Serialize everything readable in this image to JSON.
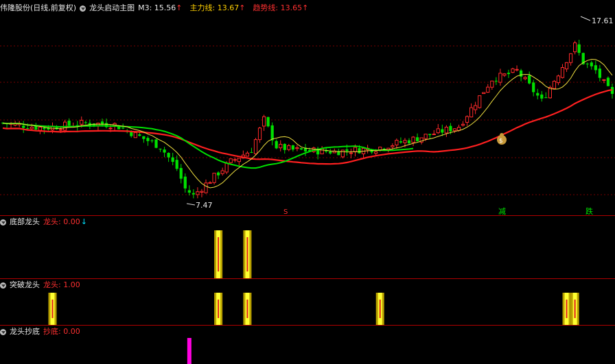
{
  "main_panel": {
    "stock_name": "伟隆股份(日线,前复权)",
    "indicator_name": "龙头启动主图",
    "m3_label": "M3: 15.56",
    "main_force_label": "主力线: 13.67",
    "trend_label": "趋势线: 13.65",
    "up_arrow": "↑",
    "high_price_label": "17.61",
    "low_price_label": "7.47",
    "signal_labels": {
      "jian": "减",
      "die": "跌",
      "s": "S"
    },
    "colors": {
      "up": "#ff2a2a",
      "down": "#00e000",
      "trend": "#ff2020",
      "main_force": "#00e000",
      "m3": "#f0e040"
    }
  },
  "panel_bottom": {
    "title": "底部龙头",
    "value_label": "龙头: 0.00",
    "down_arrow": "↓",
    "signals": [
      "2022-04-27",
      "2022-05-10"
    ]
  },
  "panel_breakout": {
    "title": "突破龙头",
    "value_label": "龙头: 1.00",
    "signals": [
      "2021-12-15",
      "2022-04-27",
      "2022-05-10",
      "2022-08-01",
      "2022-12-05",
      "2022-12-07"
    ]
  },
  "panel_bottom_fishing": {
    "title": "龙头抄底",
    "value_label": "抄底: 0.00",
    "signals": [
      "2022-03-25"
    ]
  },
  "chart_data": {
    "type": "candlestick",
    "count": 148,
    "high": 17.61,
    "low": 7.47,
    "ylim": [
      7.0,
      18.3
    ]
  }
}
